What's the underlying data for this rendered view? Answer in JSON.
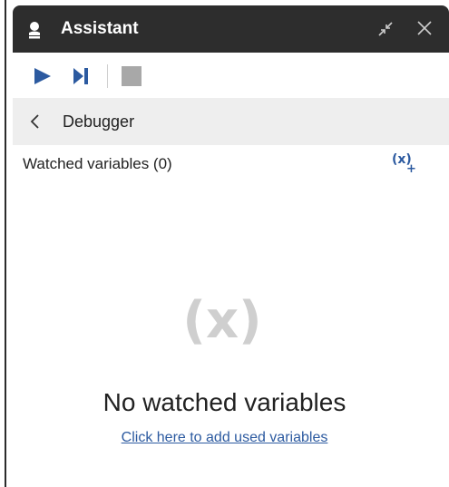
{
  "window": {
    "title": "Assistant",
    "title_icon": "assistant-icon",
    "shrink_icon": "shrink-icon",
    "close_icon": "close-icon"
  },
  "toolbar": {
    "run_icon": "play-icon",
    "step_icon": "step-forward-icon",
    "stop_icon": "stop-icon"
  },
  "debugger": {
    "back_icon": "chevron-left-icon",
    "title": "Debugger",
    "watched_label": "Watched variables (0)",
    "add_variable_icon": "add-variable-icon",
    "add_variable_x": "(x)",
    "add_variable_plus": "+"
  },
  "empty_state": {
    "icon_text": "(x)",
    "title": "No watched variables",
    "link": "Click here to add used variables"
  },
  "colors": {
    "titlebar": "#2d2d2d",
    "accent": "#2c5aa0",
    "header_bg": "#eeeeee",
    "muted_icon": "#cfcfcf",
    "stop": "#a8a8a8"
  }
}
